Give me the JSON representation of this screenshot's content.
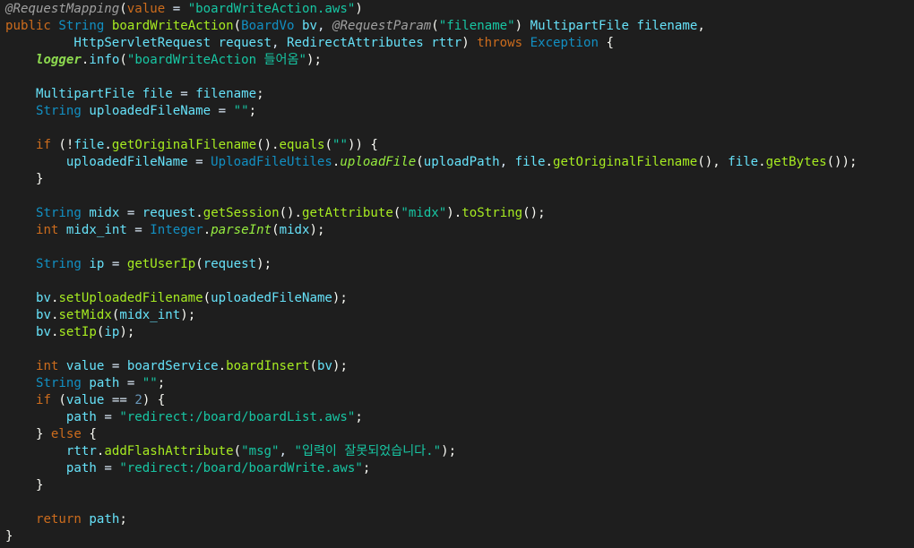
{
  "editor": {
    "lines": [
      [
        [
          "@RequestMapping",
          "annotation"
        ],
        [
          "(",
          "punct"
        ],
        [
          "value",
          "keyword"
        ],
        [
          " = ",
          "plain"
        ],
        [
          "\"boardWriteAction.aws\"",
          "string"
        ],
        [
          ")",
          "punct"
        ]
      ],
      [
        [
          "public",
          "keyword"
        ],
        [
          " ",
          "plain"
        ],
        [
          "String",
          "type"
        ],
        [
          " ",
          "plain"
        ],
        [
          "boardWriteAction",
          "method"
        ],
        [
          "(",
          "punct"
        ],
        [
          "BoardVo",
          "type"
        ],
        [
          " ",
          "plain"
        ],
        [
          "bv",
          "ident"
        ],
        [
          ", ",
          "plain"
        ],
        [
          "@RequestParam",
          "annotation"
        ],
        [
          "(",
          "punct"
        ],
        [
          "\"filename\"",
          "string"
        ],
        [
          ") ",
          "punct"
        ],
        [
          "MultipartFile",
          "ident"
        ],
        [
          " ",
          "plain"
        ],
        [
          "filename",
          "ident"
        ],
        [
          ",",
          "punct"
        ]
      ],
      [
        [
          "         ",
          "plain"
        ],
        [
          "HttpServletRequest",
          "ident"
        ],
        [
          " ",
          "plain"
        ],
        [
          "request",
          "ident"
        ],
        [
          ", ",
          "plain"
        ],
        [
          "RedirectAttributes",
          "ident"
        ],
        [
          " ",
          "plain"
        ],
        [
          "rttr",
          "ident"
        ],
        [
          ") ",
          "punct"
        ],
        [
          "throws",
          "keyword"
        ],
        [
          " ",
          "plain"
        ],
        [
          "Exception",
          "type"
        ],
        [
          " {",
          "punct"
        ]
      ],
      [
        [
          "    ",
          "plain"
        ],
        [
          "logger",
          "static-field"
        ],
        [
          ".",
          "punct"
        ],
        [
          "info",
          "ident"
        ],
        [
          "(",
          "punct"
        ],
        [
          "\"boardWriteAction 들어옴\"",
          "string"
        ],
        [
          ");",
          "punct"
        ]
      ],
      [],
      [
        [
          "    ",
          "plain"
        ],
        [
          "MultipartFile",
          "ident"
        ],
        [
          " ",
          "plain"
        ],
        [
          "file",
          "ident"
        ],
        [
          " = ",
          "plain"
        ],
        [
          "filename",
          "ident"
        ],
        [
          ";",
          "punct"
        ]
      ],
      [
        [
          "    ",
          "plain"
        ],
        [
          "String",
          "type"
        ],
        [
          " ",
          "plain"
        ],
        [
          "uploadedFileName",
          "ident"
        ],
        [
          " = ",
          "plain"
        ],
        [
          "\"\"",
          "string"
        ],
        [
          ";",
          "punct"
        ]
      ],
      [],
      [
        [
          "    ",
          "plain"
        ],
        [
          "if",
          "keyword"
        ],
        [
          " (!",
          "punct"
        ],
        [
          "file",
          "ident"
        ],
        [
          ".",
          "punct"
        ],
        [
          "getOriginalFilename",
          "method"
        ],
        [
          "().",
          "punct"
        ],
        [
          "equals",
          "method"
        ],
        [
          "(",
          "punct"
        ],
        [
          "\"\"",
          "string"
        ],
        [
          ")) {",
          "punct"
        ]
      ],
      [
        [
          "        ",
          "plain"
        ],
        [
          "uploadedFileName",
          "ident"
        ],
        [
          " = ",
          "plain"
        ],
        [
          "UploadFileUtiles",
          "type"
        ],
        [
          ".",
          "punct"
        ],
        [
          "uploadFile",
          "static-method"
        ],
        [
          "(",
          "punct"
        ],
        [
          "uploadPath",
          "ident"
        ],
        [
          ", ",
          "plain"
        ],
        [
          "file",
          "ident"
        ],
        [
          ".",
          "punct"
        ],
        [
          "getOriginalFilename",
          "method"
        ],
        [
          "(), ",
          "punct"
        ],
        [
          "file",
          "ident"
        ],
        [
          ".",
          "punct"
        ],
        [
          "getBytes",
          "method"
        ],
        [
          "());",
          "punct"
        ]
      ],
      [
        [
          "    }",
          "punct"
        ]
      ],
      [],
      [
        [
          "    ",
          "plain"
        ],
        [
          "String",
          "type"
        ],
        [
          " ",
          "plain"
        ],
        [
          "midx",
          "ident"
        ],
        [
          " = ",
          "plain"
        ],
        [
          "request",
          "ident"
        ],
        [
          ".",
          "punct"
        ],
        [
          "getSession",
          "method"
        ],
        [
          "().",
          "punct"
        ],
        [
          "getAttribute",
          "method"
        ],
        [
          "(",
          "punct"
        ],
        [
          "\"midx\"",
          "string"
        ],
        [
          ").",
          "punct"
        ],
        [
          "toString",
          "method"
        ],
        [
          "();",
          "punct"
        ]
      ],
      [
        [
          "    ",
          "plain"
        ],
        [
          "int",
          "keyword"
        ],
        [
          " ",
          "plain"
        ],
        [
          "midx_int",
          "ident"
        ],
        [
          " = ",
          "plain"
        ],
        [
          "Integer",
          "type"
        ],
        [
          ".",
          "punct"
        ],
        [
          "parseInt",
          "static-method"
        ],
        [
          "(",
          "punct"
        ],
        [
          "midx",
          "ident"
        ],
        [
          ");",
          "punct"
        ]
      ],
      [],
      [
        [
          "    ",
          "plain"
        ],
        [
          "String",
          "type"
        ],
        [
          " ",
          "plain"
        ],
        [
          "ip",
          "ident"
        ],
        [
          " = ",
          "plain"
        ],
        [
          "getUserIp",
          "method"
        ],
        [
          "(",
          "punct"
        ],
        [
          "request",
          "ident"
        ],
        [
          ");",
          "punct"
        ]
      ],
      [],
      [
        [
          "    ",
          "plain"
        ],
        [
          "bv",
          "ident"
        ],
        [
          ".",
          "punct"
        ],
        [
          "setUploadedFilename",
          "method"
        ],
        [
          "(",
          "punct"
        ],
        [
          "uploadedFileName",
          "ident"
        ],
        [
          ");",
          "punct"
        ]
      ],
      [
        [
          "    ",
          "plain"
        ],
        [
          "bv",
          "ident"
        ],
        [
          ".",
          "punct"
        ],
        [
          "setMidx",
          "method"
        ],
        [
          "(",
          "punct"
        ],
        [
          "midx_int",
          "ident"
        ],
        [
          ");",
          "punct"
        ]
      ],
      [
        [
          "    ",
          "plain"
        ],
        [
          "bv",
          "ident"
        ],
        [
          ".",
          "punct"
        ],
        [
          "setIp",
          "method"
        ],
        [
          "(",
          "punct"
        ],
        [
          "ip",
          "ident"
        ],
        [
          ");",
          "punct"
        ]
      ],
      [],
      [
        [
          "    ",
          "plain"
        ],
        [
          "int",
          "keyword"
        ],
        [
          " ",
          "plain"
        ],
        [
          "value",
          "ident"
        ],
        [
          " = ",
          "plain"
        ],
        [
          "boardService",
          "ident"
        ],
        [
          ".",
          "punct"
        ],
        [
          "boardInsert",
          "method"
        ],
        [
          "(",
          "punct"
        ],
        [
          "bv",
          "ident"
        ],
        [
          ");",
          "punct"
        ]
      ],
      [
        [
          "    ",
          "plain"
        ],
        [
          "String",
          "type"
        ],
        [
          " ",
          "plain"
        ],
        [
          "path",
          "ident"
        ],
        [
          " = ",
          "plain"
        ],
        [
          "\"\"",
          "string"
        ],
        [
          ";",
          "punct"
        ]
      ],
      [
        [
          "    ",
          "plain"
        ],
        [
          "if",
          "keyword"
        ],
        [
          " (",
          "punct"
        ],
        [
          "value",
          "ident"
        ],
        [
          " == ",
          "plain"
        ],
        [
          "2",
          "number"
        ],
        [
          ") {",
          "punct"
        ]
      ],
      [
        [
          "        ",
          "plain"
        ],
        [
          "path",
          "ident"
        ],
        [
          " = ",
          "plain"
        ],
        [
          "\"redirect:/board/boardList.aws\"",
          "string"
        ],
        [
          ";",
          "punct"
        ]
      ],
      [
        [
          "    } ",
          "punct"
        ],
        [
          "else",
          "keyword"
        ],
        [
          " {",
          "punct"
        ]
      ],
      [
        [
          "        ",
          "plain"
        ],
        [
          "rttr",
          "ident"
        ],
        [
          ".",
          "punct"
        ],
        [
          "addFlashAttribute",
          "method"
        ],
        [
          "(",
          "punct"
        ],
        [
          "\"msg\"",
          "string"
        ],
        [
          ", ",
          "plain"
        ],
        [
          "\"입력이 잘못되었습니다.\"",
          "string"
        ],
        [
          ");",
          "punct"
        ]
      ],
      [
        [
          "        ",
          "plain"
        ],
        [
          "path",
          "ident"
        ],
        [
          " = ",
          "plain"
        ],
        [
          "\"redirect:/board/boardWrite.aws\"",
          "string"
        ],
        [
          ";",
          "punct"
        ]
      ],
      [
        [
          "    }",
          "punct"
        ]
      ],
      [],
      [
        [
          "    ",
          "plain"
        ],
        [
          "return",
          "keyword"
        ],
        [
          " ",
          "plain"
        ],
        [
          "path",
          "ident"
        ],
        [
          ";",
          "punct"
        ]
      ],
      [
        [
          "}",
          "punct"
        ]
      ]
    ]
  }
}
